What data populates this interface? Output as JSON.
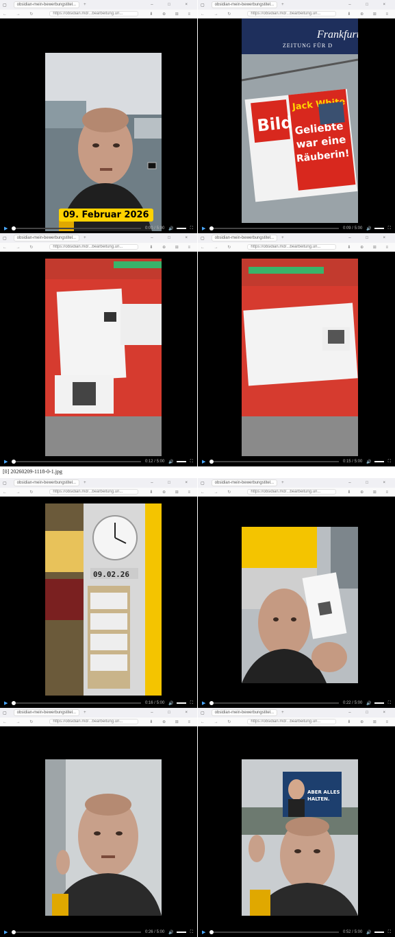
{
  "caption": "[0] 20260209-1118-0-1.jpg",
  "browser": {
    "tab_title": "obsidian-mein-bewerbungstitel...",
    "new_tab": "+",
    "url": "https://obsidian.md/...bearbeitung.un...",
    "nav_glyphs": "← → ↻",
    "window_glyphs": "– □ ×",
    "tool_glyphs": "⬇ ⊕ ⊞ ≡"
  },
  "frames": [
    {
      "time": "0:00 / 5:00",
      "banner": "09. Februar 2026"
    },
    {
      "time": "0:09 / 5:00"
    },
    {
      "time": "0:12 / 5:00"
    },
    {
      "time": "0:15 / 5:00"
    },
    {
      "time": "0:16 / 5:00"
    },
    {
      "time": "0:22 / 5:00"
    },
    {
      "time": "0:26 / 5:00"
    },
    {
      "time": "0:52 / 5:00"
    }
  ],
  "newspaper": {
    "masthead": "ZEITUNG FÜR D",
    "paper_name": "Bild",
    "headline_1": "Jack White",
    "headline_2": "Geliebte",
    "headline_3": "war eine",
    "headline_4": "Räuberin!"
  },
  "clock_counter": "09.02.26",
  "poster": {
    "line1": "ABER ALLES",
    "line2": "HALTEN."
  },
  "colors": {
    "yellow": "#ffd200",
    "post_yellow": "#f4c400",
    "red_counter": "#d8362c",
    "player_accent": "#4aa8ff"
  }
}
